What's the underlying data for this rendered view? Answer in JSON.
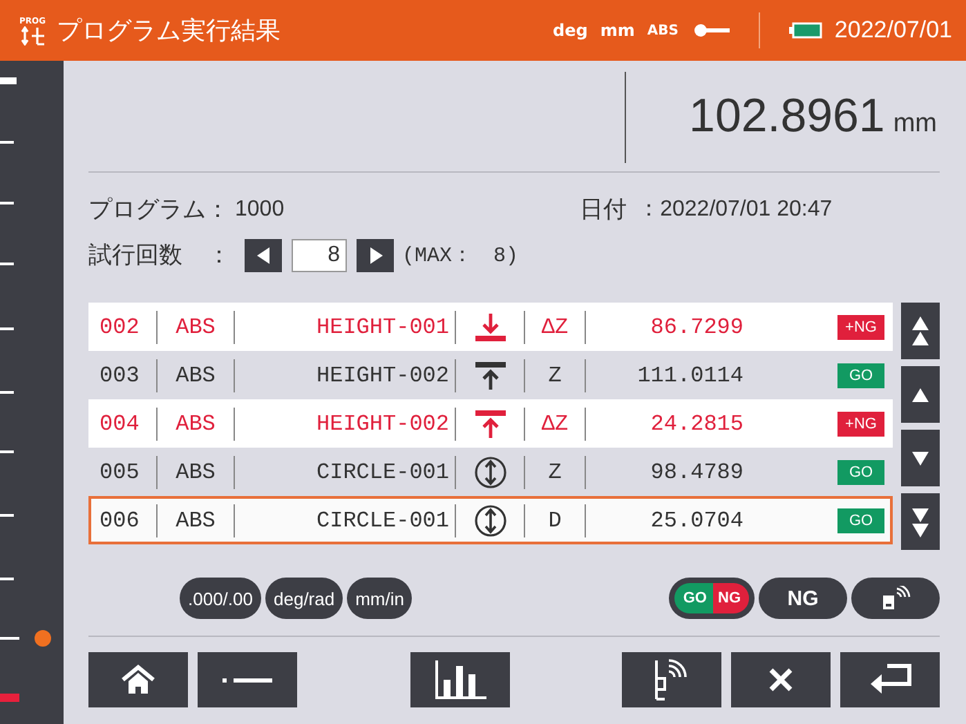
{
  "header": {
    "badge": "PROG",
    "title": "プログラム実行結果",
    "status": [
      "deg",
      "mm",
      "ABS"
    ],
    "date": "2022/07/01"
  },
  "measurement": {
    "value": "102.8961",
    "unit": "mm"
  },
  "info": {
    "program_label": "プログラム：",
    "program": "1000",
    "date_label": "日付",
    "date": "：2022/07/01 20:47",
    "trial_label": "試行回数",
    "trial_sep": "：",
    "trial": "8",
    "max": "(MAX：　8)"
  },
  "rows": [
    {
      "no": "002",
      "mode": "ABS",
      "name": "HEIGHT-001",
      "kind": "bottom",
      "axis": "ΔZ",
      "value": "86.7299",
      "judgement": "+NG",
      "ng": true,
      "selected": false
    },
    {
      "no": "003",
      "mode": "ABS",
      "name": "HEIGHT-002",
      "kind": "top",
      "axis": "Z",
      "value": "111.0114",
      "judgement": "GO",
      "ng": false,
      "selected": false
    },
    {
      "no": "004",
      "mode": "ABS",
      "name": "HEIGHT-002",
      "kind": "top",
      "axis": "ΔZ",
      "value": "24.2815",
      "judgement": "+NG",
      "ng": true,
      "selected": false
    },
    {
      "no": "005",
      "mode": "ABS",
      "name": "CIRCLE-001",
      "kind": "circle",
      "axis": "Z",
      "value": "98.4789",
      "judgement": "GO",
      "ng": false,
      "selected": false
    },
    {
      "no": "006",
      "mode": "ABS",
      "name": "CIRCLE-001",
      "kind": "circle",
      "axis": "D",
      "value": "25.0704",
      "judgement": "GO",
      "ng": false,
      "selected": true
    }
  ],
  "pills": [
    ".000/.00",
    "deg/rad",
    "mm/in"
  ],
  "go_ng": {
    "go": "GO",
    "ng": "NG"
  },
  "ng_button": "NG"
}
